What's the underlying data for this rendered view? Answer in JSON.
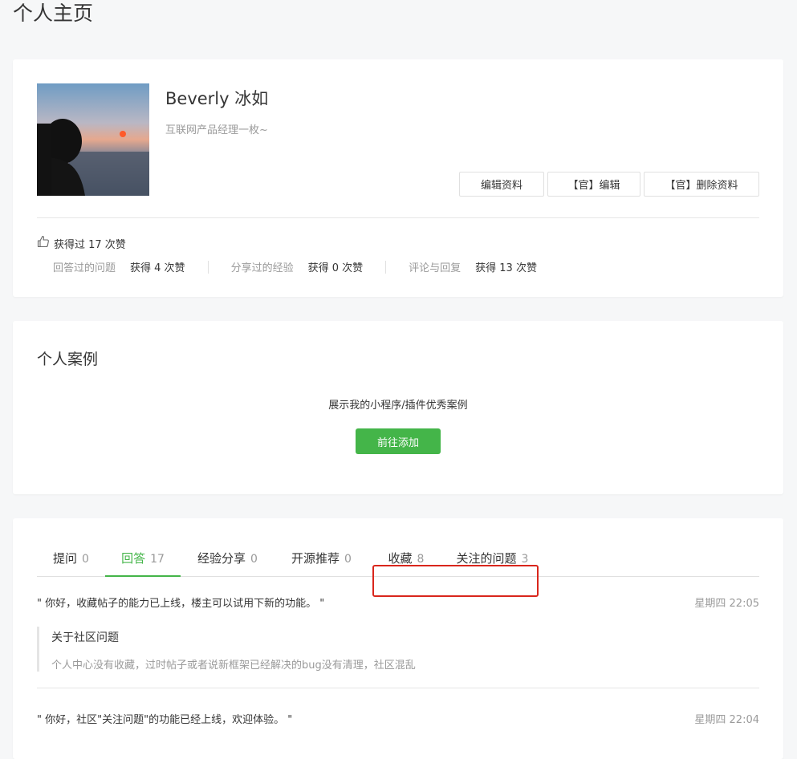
{
  "page_title": "个人主页",
  "profile": {
    "name": "Beverly 冰如",
    "bio": "互联网产品经理一枚~",
    "buttons": {
      "edit": "编辑资料",
      "admin_edit": "【官】编辑",
      "admin_delete": "【官】删除资料"
    },
    "likes_total": "获得过 17 次赞",
    "stats": [
      {
        "label": "回答过的问题",
        "value": "获得 4 次赞"
      },
      {
        "label": "分享过的经验",
        "value": "获得 0 次赞"
      },
      {
        "label": "评论与回复",
        "value": "获得 13 次赞"
      }
    ]
  },
  "cases": {
    "title": "个人案例",
    "description": "展示我的小程序/插件优秀案例",
    "add_button": "前往添加"
  },
  "tabs": [
    {
      "label": "提问",
      "count": "0"
    },
    {
      "label": "回答",
      "count": "17"
    },
    {
      "label": "经验分享",
      "count": "0"
    },
    {
      "label": "开源推荐",
      "count": "0"
    },
    {
      "label": "收藏",
      "count": "8"
    },
    {
      "label": "关注的问题",
      "count": "3"
    }
  ],
  "active_tab": "回答",
  "entries": [
    {
      "quote": "\" 你好，收藏帖子的能力已上线，楼主可以试用下新的功能。 \"",
      "time": "星期四 22:05",
      "ref_title": "关于社区问题",
      "ref_excerpt": "个人中心没有收藏，过时帖子或者说新框架已经解决的bug没有清理，社区混乱"
    },
    {
      "quote": "\" 你好，社区\"关注问题\"的功能已经上线，欢迎体验。 \"",
      "time": "星期四 22:04"
    }
  ],
  "colors": {
    "accent_green": "#44b549",
    "highlight_red": "#d9261c",
    "background": "#f6f7f8"
  }
}
